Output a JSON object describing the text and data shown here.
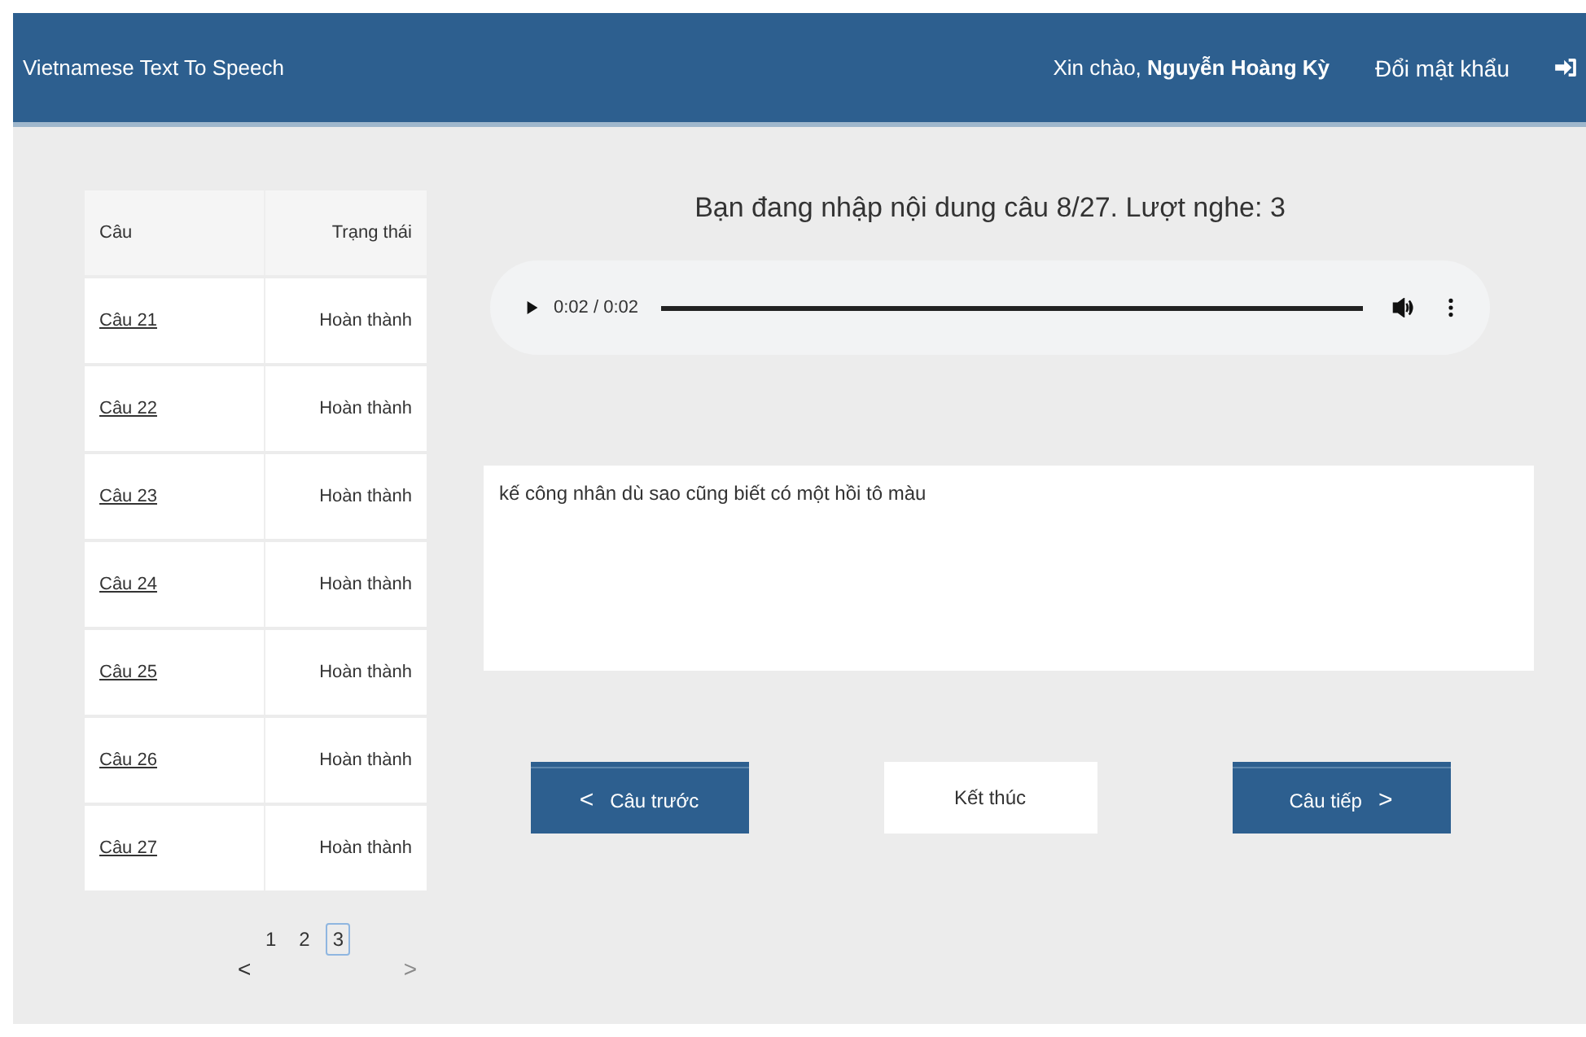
{
  "header": {
    "brand": "Vietnamese Text To Speech",
    "greeting": "Xin chào, **Nguyễn Hoàng Kỳ**",
    "change_password": "Đổi mật khẩu"
  },
  "sentence_table": {
    "columns": [
      "Câu",
      "Trạng thái"
    ],
    "rows": [
      {
        "sentence": "Câu 21",
        "status": "Hoàn thành"
      },
      {
        "sentence": "Câu 22",
        "status": "Hoàn thành"
      },
      {
        "sentence": "Câu 23",
        "status": "Hoàn thành"
      },
      {
        "sentence": "Câu 24",
        "status": "Hoàn thành"
      },
      {
        "sentence": "Câu 25",
        "status": "Hoàn thành"
      },
      {
        "sentence": "Câu 26",
        "status": "Hoàn thành"
      },
      {
        "sentence": "Câu 27",
        "status": "Hoàn thành"
      }
    ],
    "pagination": {
      "pages": [
        {
          "label": "1",
          "selected": false
        },
        {
          "label": "2",
          "selected": false
        },
        {
          "label": "3",
          "selected": true
        }
      ],
      "prev": {
        "label": "<",
        "disabled": false
      },
      "next": {
        "label": ">",
        "disabled": true
      }
    }
  },
  "title": "Bạn đang nhập nội dung câu 8/27. Lượt nghe: 3",
  "audio": {
    "time": "0:02 / 0:02",
    "level": 1
  },
  "answer": {
    "value": "kế công nhân dù sao cũng biết có một hồi tô màu"
  },
  "buttons": [
    {
      "kind": "prev",
      "label": "Câu trước",
      "arrow": "<"
    },
    {
      "kind": "finish",
      "label": "Kết thúc"
    },
    {
      "kind": "next",
      "label": "Câu tiếp",
      "arrow": ">"
    }
  ]
}
